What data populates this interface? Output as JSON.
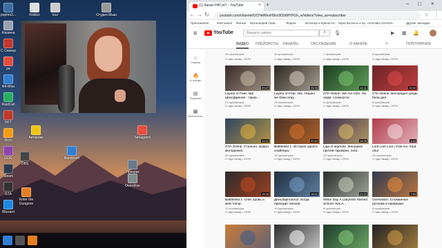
{
  "desktop": {
    "icons": [
      {
        "label": "pophm3...",
        "color": "#3a6ea5"
      },
      {
        "label": "Корзина",
        "color": "#9aa4b0"
      },
      {
        "label": "C Сканер",
        "color": "#c0392b"
      },
      {
        "label": "pa",
        "color": "#e74c3c"
      },
      {
        "label": "ФК-Мои",
        "color": "#2f7fd3"
      },
      {
        "label": "RaidCall",
        "color": "#27ae60"
      },
      {
        "label": "RFT",
        "color": "#c0392b"
      },
      {
        "label": "Фото",
        "color": "#f39c12"
      },
      {
        "label": "GOG",
        "color": "#8e44ad"
      },
      {
        "label": "Steam",
        "color": "#2c3e50"
      },
      {
        "label": "GTA",
        "color": "#333333"
      },
      {
        "label": "Blizzard",
        "color": "#1e88e5"
      }
    ],
    "top_icons": [
      {
        "label": "Roblox",
        "color": "#dddddd"
      },
      {
        "label": "tour",
        "color": "#cccccc"
      },
      {
        "label": "Студия Мыш",
        "color": "#999999"
      }
    ],
    "mid_icons": [
      {
        "label": "Автоклик",
        "color": "#f1c40f"
      },
      {
        "label": "Tamagotch",
        "color": "#e74c3c"
      },
      {
        "label": "Bandicam",
        "color": "#2f7fd3"
      },
      {
        "label": "OBS",
        "color": "#444444"
      },
      {
        "label": "Пpизрак",
        "color": "#6c7a89"
      },
      {
        "label": "Overdrive",
        "color": "#7f8c8d"
      },
      {
        "label": "Enter the Gungeon",
        "color": "#e67e22"
      }
    ]
  },
  "browser": {
    "tab_title": "(1) Канал Н4ГэлТ - YouTube",
    "url": "youtube.com/channel/UCHetNhoFl8oc902dMYPGh_w/videos?view_as=subscriber",
    "bookmarks": [
      "Приложения",
      "Мой канал",
      "Фильм",
      "Мультиорий Грав...",
      "Яндекс",
      "Волчица и пряности...",
      "Мука Волчьчь и пр...",
      "Anomalia Geomet...",
      "Другие закладки"
    ],
    "search_placeholder": "Введите запрос",
    "logo_text": "YouTube",
    "channel_tabs": [
      "ВИДЕО",
      "ПЛЕЙЛИСТЫ",
      "КАНАЛЫ",
      "ОБСУЖДЕНИЕ",
      "О КАНАЛЕ"
    ],
    "sort_label": "ПОПУЛЯРНОЕ",
    "guide": [
      {
        "icon": "⌂",
        "label": "Главная"
      },
      {
        "icon": "🔥",
        "label": "В тренде"
      },
      {
        "icon": "▤",
        "label": "Подписки"
      },
      {
        "icon": "▦",
        "label": "Библиотека"
      }
    ],
    "top_row_meta": [
      {
        "views": "26 просмотров",
        "age": "2 года назад • 100%"
      },
      {
        "views": "11 просмотров",
        "age": "2 года назад • 100%"
      },
      {
        "views": "7 просмотров",
        "age": "2 года назад • 100%"
      },
      {
        "views": "6 просмотров",
        "age": "2 года назад • 100%"
      }
    ],
    "videos": [
      {
        "title": "Layers of Fear. №2. Шизофрения - такая...",
        "views": "21 просмотров",
        "age": "2 года назад • 100%",
        "duration": "29:47",
        "bg": "#3a2a2a",
        "accent": "#c9c0a8"
      },
      {
        "title": "Layers of Fear. №1. Нашел же блин игру...",
        "views": "15 просмотров",
        "age": "2 года назад • 100%",
        "duration": "25:35",
        "bg": "#2c2622",
        "accent": "#d8d0c0"
      },
      {
        "title": "GTA Online: We Are One. На норм. сложности",
        "views": "8 просмотров",
        "age": "2 года назад • 100%",
        "duration": "14:41",
        "bg": "#1d3b22",
        "accent": "#7bc96f"
      },
      {
        "title": "GTA Online. Беспредел средь бела дня",
        "views": "5 просмотров",
        "age": "2 года назад • 100%",
        "duration": "10:52",
        "bg": "#6a2326",
        "accent": "#e24a4a"
      },
      {
        "title": "GTA Online. Стильно, модно, молодежно.",
        "views": "24 просмотров",
        "age": "2 года назад • 100%",
        "duration": "11:12",
        "bg": "#2e4562",
        "accent": "#e8b43a"
      },
      {
        "title": "Battlefield 1. История одного снайпера.",
        "views": "14 просмотров",
        "age": "2 года назад • 100%",
        "duration": "20:54",
        "bg": "#4a3322",
        "accent": "#d9732c"
      },
      {
        "title": "Liga of legends. Женщина против тараканa. 1vs1.",
        "views": "12 просмотров",
        "age": "2 года назад • 100%",
        "duration": "14:06",
        "bg": "#3c2e52",
        "accent": "#e2c16a"
      },
      {
        "title": "Lool Loo! Lool | Yuki Aoi. hard. osu!",
        "views": "10 просмотров",
        "age": "2 года назад • 100%",
        "duration": "1:44",
        "bg": "#b13d4b",
        "accent": "#f5e0e6"
      },
      {
        "title": "Battlefield 1. Снег, кровь и мой топор.",
        "views": "11 просмотров",
        "age": "2 года назад • 100%",
        "duration": "15:08",
        "bg": "#2b2a2d",
        "accent": "#c8491f"
      },
      {
        "title": "ДеньЗарплаты2. Когда приходит пенсия.",
        "views": "10 просмотров",
        "age": "2 года назад • 100%",
        "duration": "18:31",
        "bg": "#1e2e3e",
        "accent": "#7aa0c8"
      },
      {
        "title": "White Day A Labyrinth Named School. Как я...",
        "views": "9 просмотров",
        "age": "2 года назад • 100%",
        "duration": "21:37",
        "bg": "#2a2e2a",
        "accent": "#cfd4c6"
      },
      {
        "title": "Overwatch. Сломанные ручонки и нервишки.",
        "views": "8 просмотров",
        "age": "2 года назад • 100%",
        "duration": "7:50",
        "bg": "#2f3a4e",
        "accent": "#f28f3b"
      },
      {
        "title": "",
        "views": "",
        "age": "",
        "duration": "",
        "bg": "#c97b3a",
        "accent": "#3a5a8a"
      },
      {
        "title": "",
        "views": "",
        "age": "",
        "duration": "",
        "bg": "#2b2b2b",
        "accent": "#ffffff"
      },
      {
        "title": "",
        "views": "",
        "age": "",
        "duration": "",
        "bg": "#1c3a2a",
        "accent": "#8bd17c"
      },
      {
        "title": "",
        "views": "",
        "age": "",
        "duration": "",
        "bg": "#222222",
        "accent": "#d6a04a"
      }
    ]
  }
}
